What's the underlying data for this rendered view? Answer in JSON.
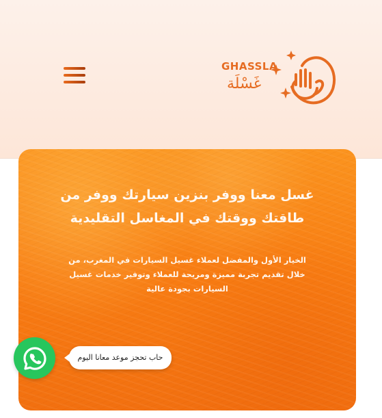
{
  "header": {
    "logo": {
      "latin_text": "GHASSLA",
      "arabic_text": "غَسْلَة",
      "mark_icon": "hand-wave-icon"
    },
    "menu_icon": "hamburger-menu-icon"
  },
  "hero": {
    "heading": "غسل معنا ووفر بنزين سيارتك ووفر من طاقتك ووقتك في المغاسل التقليدية",
    "description": "الخيار الأول والمفضل لعملاء غسيل السيارات في المغرب، من خلال تقديم تجربة مميزة ومريحة للعملاء وتوفير خدمات غسيل السيارات بجودة عالية"
  },
  "whatsapp": {
    "icon": "whatsapp-icon",
    "tooltip": "حاب تحجز موعد معانا اليوم"
  },
  "colors": {
    "brand_orange": "#e66c22",
    "hero_orange": "#f87d13",
    "whatsapp_green": "#27c65d",
    "header_bg": "#fdeee5"
  }
}
